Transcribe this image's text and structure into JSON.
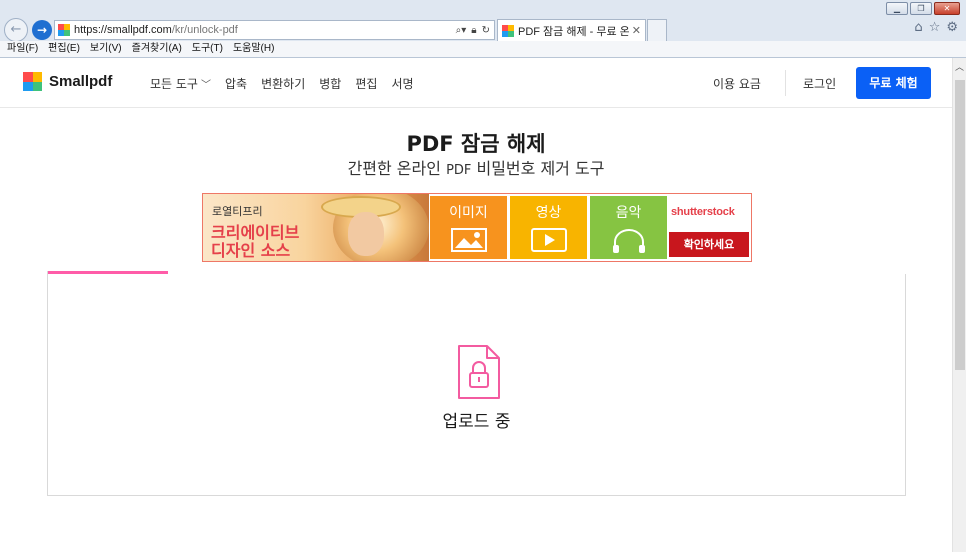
{
  "browser": {
    "url_main": "https://smallpdf.com",
    "url_path": "/kr/unlock-pdf",
    "tab_title": "PDF 잠금 해제 - 무료 온라...",
    "window_controls": [
      "minimize",
      "restore",
      "close"
    ],
    "menu": [
      "파일(F)",
      "편집(E)",
      "보기(V)",
      "즐겨찾기(A)",
      "도구(T)",
      "도움말(H)"
    ]
  },
  "site": {
    "brand": "Smallpdf",
    "brand_colors": [
      "#ff4b4b",
      "#ffba00",
      "#1f9bf0",
      "#3fc27c"
    ],
    "nav": {
      "all_tools": "모든 도구",
      "compress": "압축",
      "convert": "변환하기",
      "merge": "병합",
      "edit": "편집",
      "sign": "서명"
    },
    "pricing": "이용 요금",
    "login": "로그인",
    "trial": "무료 체험"
  },
  "main": {
    "title": "PDF 잠금 해제",
    "subtitle_prefix": "간편한 온라인 ",
    "subtitle_pdf": "PDF",
    "subtitle_suffix": " 비밀번호 제거 도구"
  },
  "ad": {
    "tagline": "로열티프리",
    "headline_1": "크리에이티브",
    "headline_2": "디자인 소스",
    "tiles": {
      "image": "이미지",
      "video": "영상",
      "music": "음악"
    },
    "brand": "shutterstock",
    "cta": "확인하세요"
  },
  "upload": {
    "status": "업로드 중",
    "progress": 0.14,
    "accent": "#ff5ca8"
  }
}
